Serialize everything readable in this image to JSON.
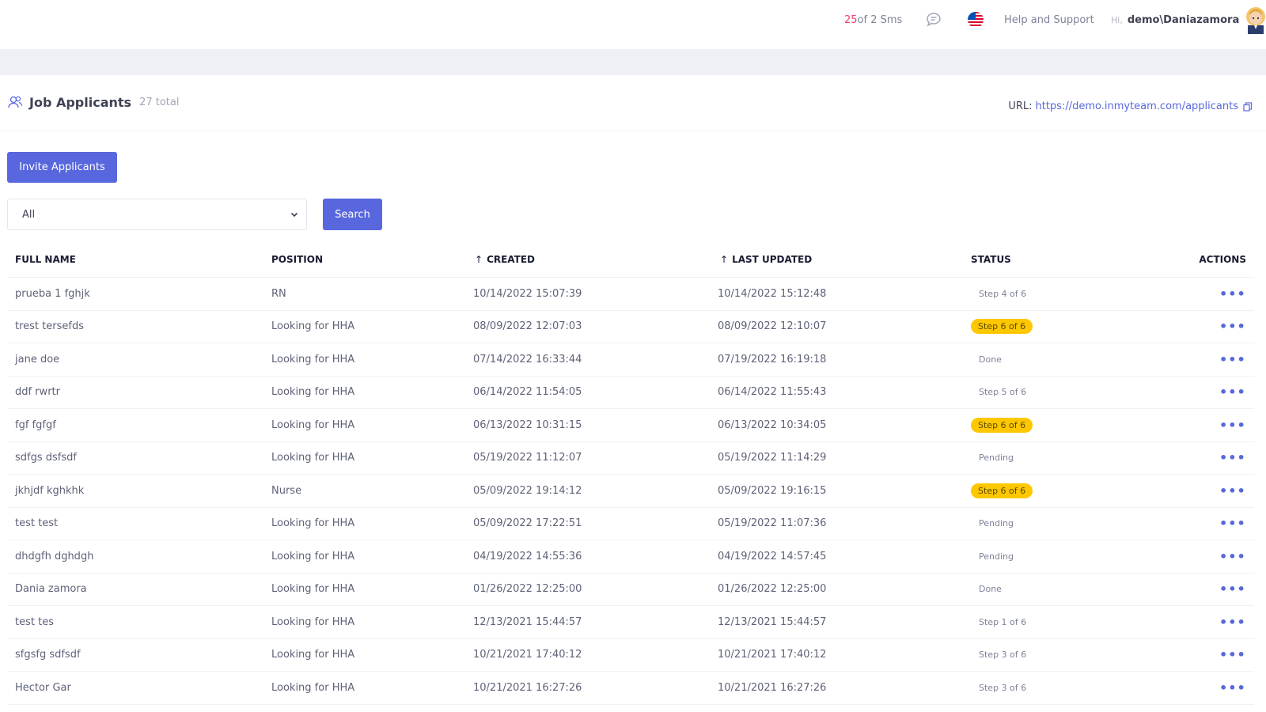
{
  "topbar": {
    "sms_count": "25",
    "sms_text": " of 2 Sms",
    "help": "Help and Support",
    "hi": "Hi,",
    "user": "demo\\Daniazamora",
    "icons": [
      "chat-icon",
      "us-flag-icon",
      "avatar"
    ]
  },
  "header": {
    "title": "Job Applicants",
    "total": "27 total",
    "url_label": "URL:",
    "url": "https://demo.inmyteam.com/applicants"
  },
  "toolbar": {
    "invite_label": "Invite Applicants",
    "filter_value": "All",
    "search_label": "Search"
  },
  "table": {
    "columns": {
      "name": "FULL NAME",
      "position": "POSITION",
      "created": "CREATED",
      "updated": "LAST UPDATED",
      "status": "STATUS",
      "actions": "ACTIONS"
    },
    "rows": [
      {
        "name": "prueba 1 fghjk",
        "position": "RN",
        "created": "10/14/2022 15:07:39",
        "updated": "10/14/2022 15:12:48",
        "status": "Step 4 of 6",
        "highlight": false
      },
      {
        "name": "trest tersefds",
        "position": "Looking for HHA",
        "created": "08/09/2022 12:07:03",
        "updated": "08/09/2022 12:10:07",
        "status": "Step 6 of 6",
        "highlight": true
      },
      {
        "name": "jane doe",
        "position": "Looking for HHA",
        "created": "07/14/2022 16:33:44",
        "updated": "07/19/2022 16:19:18",
        "status": "Done",
        "highlight": false
      },
      {
        "name": "ddf rwrtr",
        "position": "Looking for HHA",
        "created": "06/14/2022 11:54:05",
        "updated": "06/14/2022 11:55:43",
        "status": "Step 5 of 6",
        "highlight": false
      },
      {
        "name": "fgf fgfgf",
        "position": "Looking for HHA",
        "created": "06/13/2022 10:31:15",
        "updated": "06/13/2022 10:34:05",
        "status": "Step 6 of 6",
        "highlight": true
      },
      {
        "name": "sdfgs dsfsdf",
        "position": "Looking for HHA",
        "created": "05/19/2022 11:12:07",
        "updated": "05/19/2022 11:14:29",
        "status": "Pending",
        "highlight": false
      },
      {
        "name": "jkhjdf kghkhk",
        "position": "Nurse",
        "created": "05/09/2022 19:14:12",
        "updated": "05/09/2022 19:16:15",
        "status": "Step 6 of 6",
        "highlight": true
      },
      {
        "name": "test test",
        "position": "Looking for HHA",
        "created": "05/09/2022 17:22:51",
        "updated": "05/19/2022 11:07:36",
        "status": "Pending",
        "highlight": false
      },
      {
        "name": "dhdgfh dghdgh",
        "position": "Looking for HHA",
        "created": "04/19/2022 14:55:36",
        "updated": "04/19/2022 14:57:45",
        "status": "Pending",
        "highlight": false
      },
      {
        "name": "Dania zamora",
        "position": "Looking for HHA",
        "created": "01/26/2022 12:25:00",
        "updated": "01/26/2022 12:25:00",
        "status": "Done",
        "highlight": false
      },
      {
        "name": "test tes",
        "position": "Looking for HHA",
        "created": "12/13/2021 15:44:57",
        "updated": "12/13/2021 15:44:57",
        "status": "Step 1 of 6",
        "highlight": false
      },
      {
        "name": "sfgsfg sdfsdf",
        "position": "Looking for HHA",
        "created": "10/21/2021 17:40:12",
        "updated": "10/21/2021 17:40:12",
        "status": "Step 3 of 6",
        "highlight": false
      },
      {
        "name": "Hector Gar",
        "position": "Looking for HHA",
        "created": "10/21/2021 16:27:26",
        "updated": "10/21/2021 16:27:26",
        "status": "Step 3 of 6",
        "highlight": false
      }
    ]
  },
  "colors": {
    "accent": "#5867dd",
    "warning": "#ffc700",
    "danger": "#f1416c"
  }
}
